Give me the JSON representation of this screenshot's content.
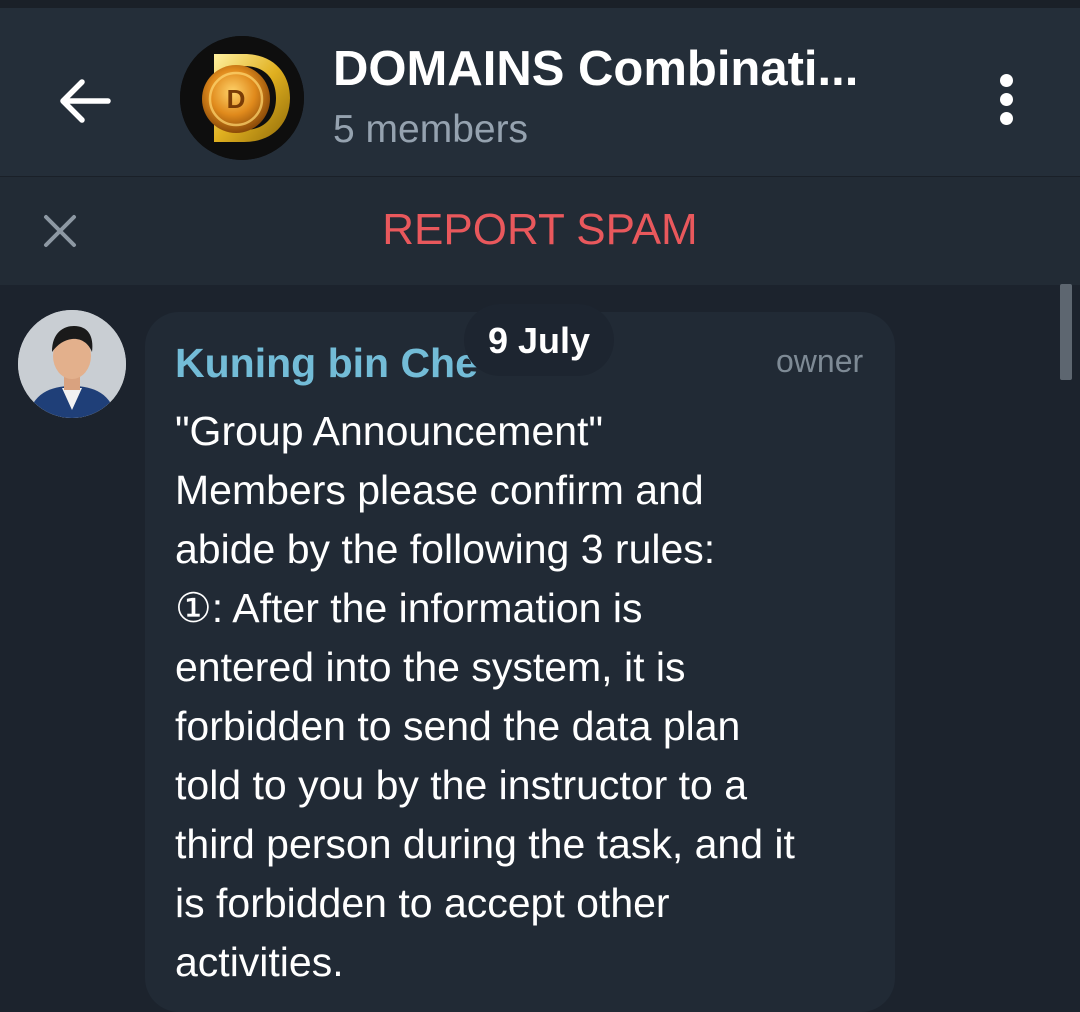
{
  "header": {
    "title": "DOMAINS Combinati...",
    "subtitle": "5 members",
    "back_icon": "arrow-left-icon",
    "menu_icon": "more-vertical-icon",
    "background": "#242e39"
  },
  "spam_bar": {
    "label": "REPORT SPAM",
    "close_icon": "close-icon",
    "label_color": "#e9585c"
  },
  "date_chip": "9 July",
  "message": {
    "sender": "Kuning bin Che",
    "role": "owner",
    "name_color": "#73bcd7",
    "lines": [
      "\"Group Announcement\"",
      "Members please confirm and",
      "abide by the following 3 rules:",
      "①: After the information is",
      "entered into the system, it is",
      "forbidden to send the data plan",
      "told to you by the instructor to a",
      "third person during the task, and it",
      "is forbidden to accept other",
      "activities."
    ]
  }
}
